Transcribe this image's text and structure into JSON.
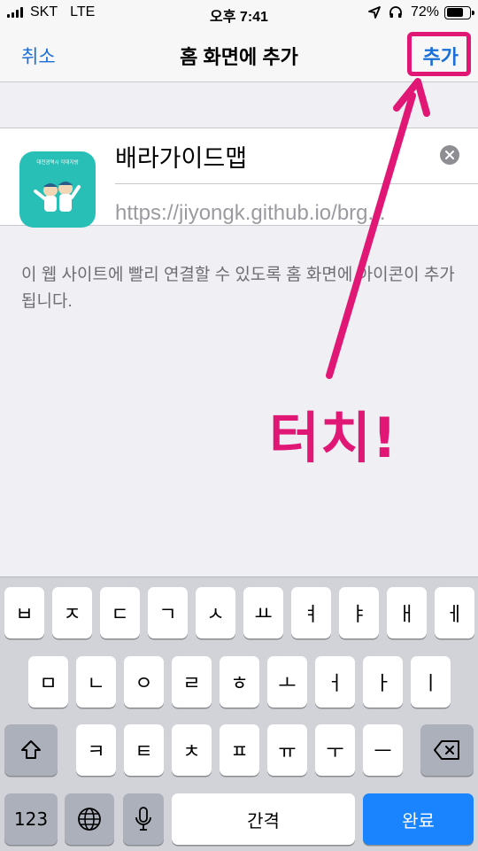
{
  "status_bar": {
    "carrier": "SKT",
    "network": "LTE",
    "time": "오후 7:41",
    "battery_pct": "72%",
    "battery_level": 0.72,
    "icons": [
      "signal-icon",
      "location-icon",
      "headphones-icon",
      "battery-icon"
    ]
  },
  "navbar": {
    "cancel_label": "취소",
    "title": "홈 화면에 추가",
    "add_label": "추가"
  },
  "bookmark": {
    "icon_title": "대전광역시 각대지방",
    "name_value": "배라가이드맵",
    "url": "https://jiyongk.github.io/brg..."
  },
  "helper_text": "이 웹 사이트에 빨리 연결할 수 있도록 홈 화면에 아이콘이 추가됩니다.",
  "annotation": "터치!",
  "colors": {
    "accent_blue": "#1a6ed8",
    "annotation_pink": "#e11776",
    "icon_teal": "#28c0b6",
    "done_blue": "#1a84ff"
  },
  "keyboard": {
    "row1": [
      "ㅂ",
      "ㅈ",
      "ㄷ",
      "ㄱ",
      "ㅅ",
      "ㅛ",
      "ㅕ",
      "ㅑ",
      "ㅐ",
      "ㅔ"
    ],
    "row2": [
      "ㅁ",
      "ㄴ",
      "ㅇ",
      "ㄹ",
      "ㅎ",
      "ㅗ",
      "ㅓ",
      "ㅏ",
      "ㅣ"
    ],
    "row3": [
      "ㅋ",
      "ㅌ",
      "ㅊ",
      "ㅍ",
      "ㅠ",
      "ㅜ",
      "ㅡ"
    ],
    "numbers_label": "123",
    "space_label": "간격",
    "done_label": "완료"
  }
}
